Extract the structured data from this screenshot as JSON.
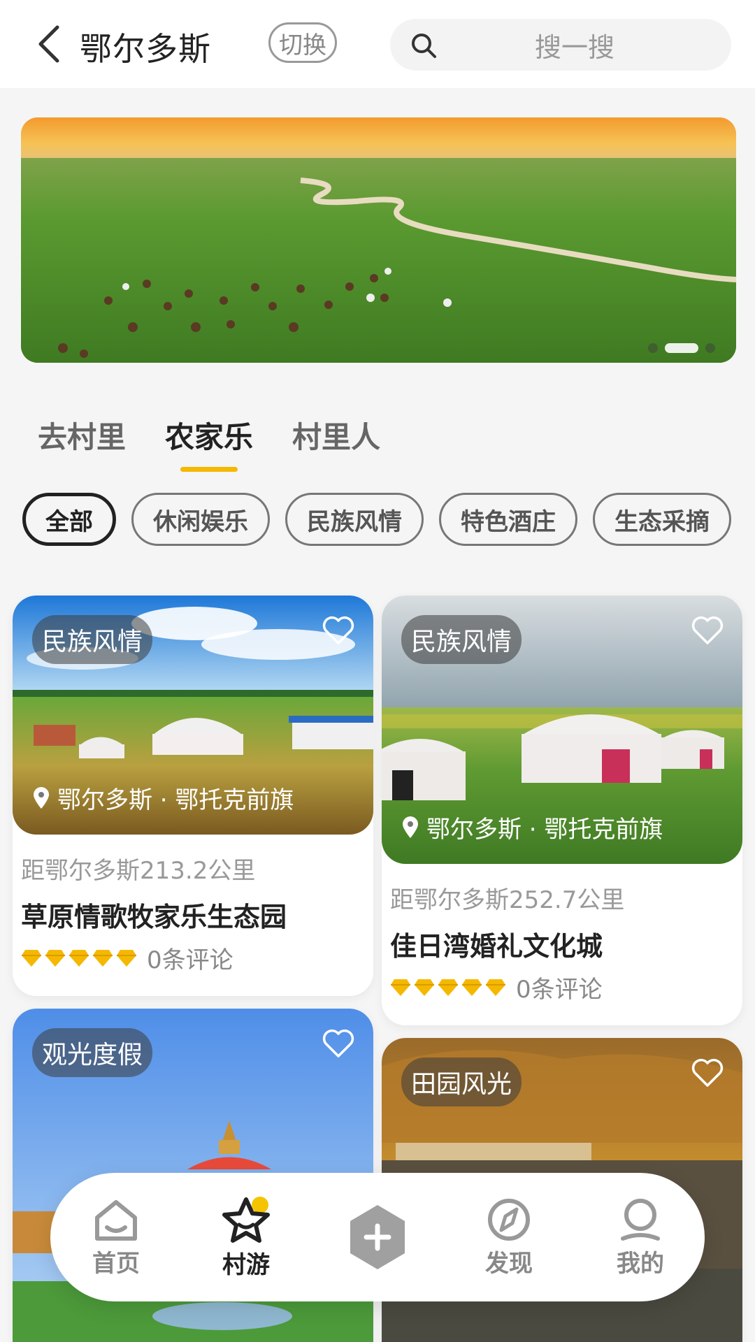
{
  "header": {
    "city": "鄂尔多斯",
    "switch_label": "切换",
    "search_placeholder": "搜一搜"
  },
  "banner": {
    "slide_count": 3,
    "active_slide": 2
  },
  "tabs": [
    {
      "label": "去村里",
      "active": false
    },
    {
      "label": "农家乐",
      "active": true
    },
    {
      "label": "村里人",
      "active": false
    }
  ],
  "filters": [
    {
      "label": "全部",
      "active": true
    },
    {
      "label": "休闲娱乐",
      "active": false
    },
    {
      "label": "民族风情",
      "active": false
    },
    {
      "label": "特色酒庄",
      "active": false
    },
    {
      "label": "生态采摘",
      "active": false
    }
  ],
  "cards": [
    {
      "tag": "民族风情",
      "location": "鄂尔多斯 · 鄂托克前旗",
      "distance": "距鄂尔多斯213.2公里",
      "name": "草原情歌牧家乐生态园",
      "rating_icons": 5,
      "reviews": "0条评论"
    },
    {
      "tag": "民族风情",
      "location": "鄂尔多斯 · 鄂托克前旗",
      "distance": "距鄂尔多斯252.7公里",
      "name": "佳日湾婚礼文化城",
      "rating_icons": 5,
      "reviews": "0条评论"
    },
    {
      "tag": "观光度假"
    },
    {
      "tag": "田园风光"
    }
  ],
  "bottom_nav": [
    {
      "label": "首页",
      "icon": "home-icon",
      "active": false
    },
    {
      "label": "村游",
      "icon": "star-icon",
      "active": true
    },
    {
      "label": "",
      "icon": "plus-icon",
      "active": false
    },
    {
      "label": "发现",
      "icon": "compass-icon",
      "active": false
    },
    {
      "label": "我的",
      "icon": "user-icon",
      "active": false
    }
  ],
  "colors": {
    "accent": "#f5b800",
    "tab_indicator": "#f5b800",
    "rating": "#f5b800"
  }
}
